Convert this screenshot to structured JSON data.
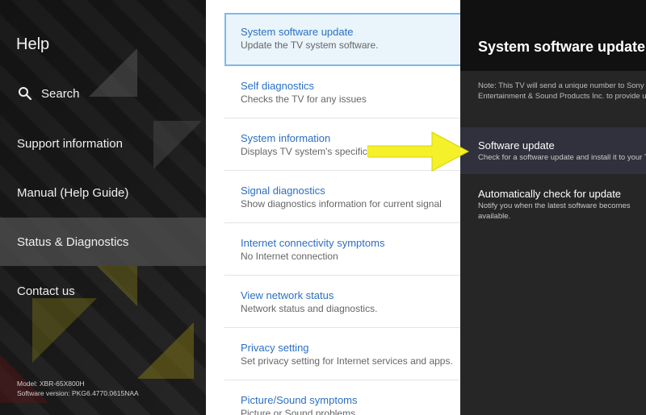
{
  "colors": {
    "link_blue": "#2b6fc4",
    "selected_border": "#7db9e8",
    "arrow_yellow": "#f4f12b"
  },
  "left": {
    "title": "Help",
    "items": [
      {
        "label": "Search",
        "icon": "search-icon"
      },
      {
        "label": "Support information"
      },
      {
        "label": "Manual (Help Guide)"
      },
      {
        "label": "Status & Diagnostics"
      },
      {
        "label": "Contact us"
      }
    ],
    "model": "Model: XBR-65X800H",
    "software_version": "Software version: PKG6.4770.0615NAA"
  },
  "middle": {
    "items": [
      {
        "title": "System software update",
        "subtitle": "Update the TV system software."
      },
      {
        "title": "Self diagnostics",
        "subtitle": "Checks the TV for any issues"
      },
      {
        "title": "System information",
        "subtitle": "Displays TV system's specific information"
      },
      {
        "title": "Signal diagnostics",
        "subtitle": "Show diagnostics information for current signal"
      },
      {
        "title": "Internet connectivity symptoms",
        "subtitle": "No Internet connection"
      },
      {
        "title": "View network status",
        "subtitle": "Network status and diagnostics."
      },
      {
        "title": "Privacy setting",
        "subtitle": "Set privacy setting for Internet services and apps."
      },
      {
        "title": "Picture/Sound symptoms",
        "subtitle": "Picture or Sound problems"
      }
    ]
  },
  "right": {
    "title": "System software update",
    "note": "Note: This TV will send a unique number to Sony Entertainment & Sound Products Inc. to provide updates.",
    "items": [
      {
        "title": "Software update",
        "subtitle": "Check for a software update and install it to your TV"
      },
      {
        "title": "Automatically check for update",
        "subtitle": "Notify you when the latest software becomes available."
      }
    ]
  }
}
